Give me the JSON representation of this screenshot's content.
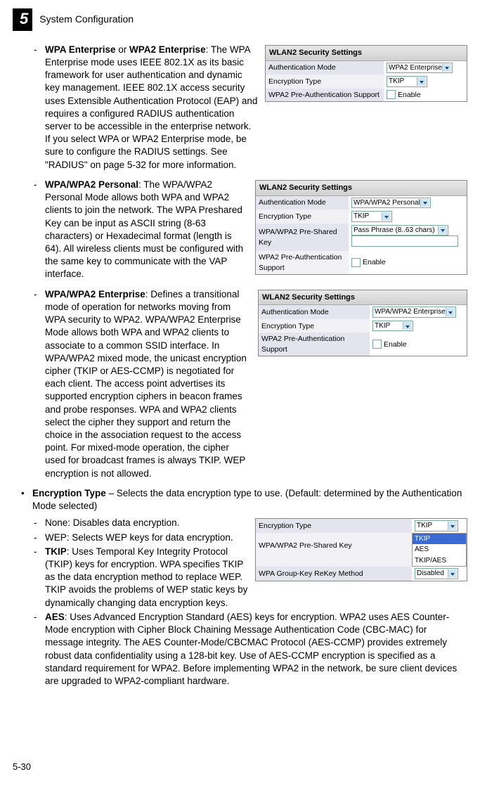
{
  "header": {
    "chapter_number": "5",
    "chapter_title": "System Configuration"
  },
  "fig1": {
    "title": "WLAN2 Security Settings",
    "r1l": "Authentication Mode",
    "r1v": "WPA2 Enterprise",
    "r2l": "Encryption Type",
    "r2v": "TKIP",
    "r3l": "WPA2 Pre-Authentication Support",
    "r3v": "Enable"
  },
  "fig2": {
    "title": "WLAN2 Security Settings",
    "r1l": "Authentication Mode",
    "r1v": "WPA/WPA2 Personal",
    "r2l": "Encryption Type",
    "r2v": "TKIP",
    "r3l": "WPA/WPA2 Pre-Shared Key",
    "r3v": "Pass Phrase (8..63 chars)",
    "r4l": "WPA2 Pre-Authentication Support",
    "r4v": "Enable"
  },
  "fig3": {
    "title": "WLAN2 Security Settings",
    "r1l": "Authentication Mode",
    "r1v": "WPA/WPA2 Enterprise",
    "r2l": "Encryption Type",
    "r2v": "TKIP",
    "r3l": "WPA2 Pre-Authentication Support",
    "r3v": "Enable"
  },
  "fig4": {
    "r1l": "Encryption Type",
    "r1v": "TKIP",
    "r2l": "WPA/WPA2 Pre-Shared Key",
    "opt1": "TKIP",
    "opt2": "AES",
    "opt3": "TKIP/AES",
    "r3l": "WPA Group-Key ReKey Method",
    "r3v": "Disabled"
  },
  "p1_lead1": "WPA Enterprise",
  "p1_or": " or ",
  "p1_lead2": "WPA2 Enterprise",
  "p1_body": ": The WPA Enterprise mode uses IEEE 802.1X as its basic framework for user authentication and dynamic key management. IEEE 802.1X access security uses Extensible Authentication Protocol (EAP) and requires a configured RADIUS authentication server to be accessible in the enterprise network. If you select WPA or WPA2 Enterprise mode, be sure to configure the RADIUS settings. See \"RADIUS\" on page 5-32 for more information.",
  "p2_lead": "WPA/WPA2 Personal",
  "p2_body": ": The WPA/WPA2 Personal Mode allows both WPA and WPA2 clients to join the network. The WPA Preshared Key can be input as ASCII string (8-63 characters) or Hexadecimal format (length is 64). All wireless clients must be configured with the same key to communicate with the VAP interface.",
  "p3_lead": "WPA/WPA2 Enterprise",
  "p3_body": ": Defines a transitional mode of operation for networks moving from WPA security to WPA2. WPA/WPA2 Enterprise Mode allows both WPA and WPA2 clients to associate to a common SSID interface. In WPA/WPA2 mixed mode, the unicast encryption cipher (TKIP or AES-CCMP) is negotiated for each client. The access point advertises its supported encryption ciphers in beacon frames and probe responses. WPA and WPA2 clients select the cipher they support and return the choice in the association request to the access point. For mixed-mode operation, the cipher used for broadcast frames is always TKIP. WEP encryption is not allowed.",
  "p4_lead": "Encryption Type",
  "p4_body": " – Selects the data encryption type to use. (Default: determined by the Authentication Mode selected)",
  "p5_body": "None: Disables data encryption.",
  "p6_body": "WEP: Selects WEP keys for data encryption.",
  "p7_lead": "TKIP",
  "p7_body": ": Uses Temporal Key Integrity Protocol (TKIP) keys for encryption. WPA specifies TKIP as the data encryption method to replace WEP. TKIP avoids the problems of WEP static keys by dynamically changing data encryption keys.",
  "p8_lead": "AES",
  "p8_body": ": Uses Advanced Encryption Standard (AES) keys for encryption. WPA2 uses AES Counter-Mode encryption with Cipher Block Chaining Message Authentication Code (CBC-MAC) for message integrity. The AES Counter-Mode/CBCMAC Protocol (AES-CCMP) provides extremely robust data confidentiality using a 128-bit key. Use of AES-CCMP encryption is specified as a standard requirement for WPA2. Before implementing WPA2 in the network, be sure client devices are upgraded to WPA2-compliant hardware.",
  "page_number": "5-30"
}
